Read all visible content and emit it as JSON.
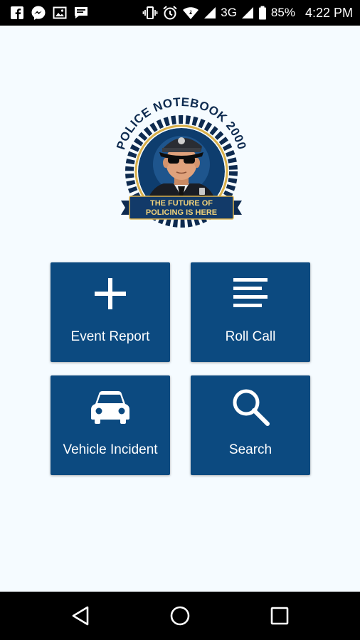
{
  "status_bar": {
    "notification_icons": [
      "facebook-icon",
      "messenger-icon",
      "gallery-icon",
      "message-icon"
    ],
    "system_icons": [
      "vibrate-icon",
      "alarm-icon",
      "wifi-icon",
      "signal-icon"
    ],
    "network": "3G",
    "battery": "85%",
    "time": "4:22 PM"
  },
  "logo": {
    "arc_text": "POLICE NOTEBOOK 2000",
    "banner_line1": "THE FUTURE OF",
    "banner_line2": "POLICING IS HERE"
  },
  "menu": [
    {
      "label": "Event Report",
      "icon": "plus-icon"
    },
    {
      "label": "Roll Call",
      "icon": "list-icon"
    },
    {
      "label": "Vehicle Incident",
      "icon": "car-icon"
    },
    {
      "label": "Search",
      "icon": "search-icon"
    }
  ],
  "colors": {
    "tile": "#0c4a80",
    "background": "#f5fbff",
    "navy": "#0d2a4f",
    "gold": "#d9b04a"
  },
  "nav_bar": {
    "buttons": [
      "back-icon",
      "home-icon",
      "recent-apps-icon"
    ]
  }
}
